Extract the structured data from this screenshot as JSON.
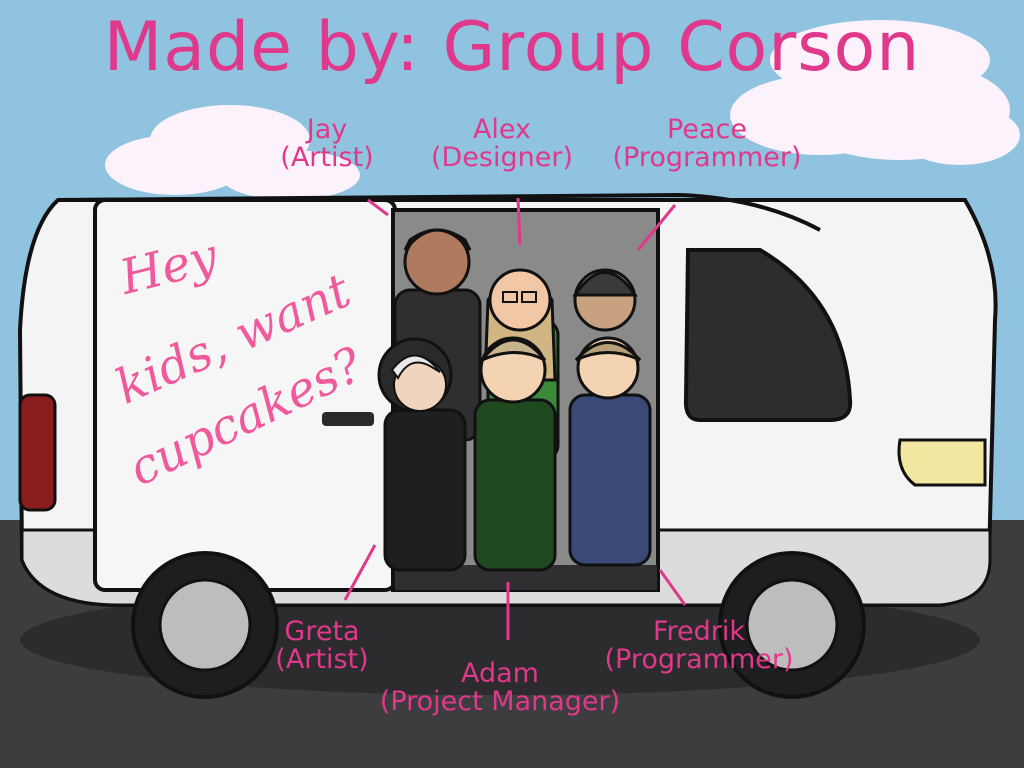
{
  "title": "Made by: Group Corson",
  "van_slogan": {
    "line1": "Hey",
    "line2": "kids, want",
    "line3": "cupcakes?"
  },
  "credits": [
    {
      "name": "Jay",
      "role": "(Artist)"
    },
    {
      "name": "Alex",
      "role": "(Designer)"
    },
    {
      "name": "Peace",
      "role": "(Programmer)"
    },
    {
      "name": "Greta",
      "role": "(Artist)"
    },
    {
      "name": "Adam",
      "role": "(Project Manager)"
    },
    {
      "name": "Fredrik",
      "role": "(Programmer)"
    }
  ],
  "colors": {
    "sky": "#8fc3e0",
    "road": "#3d3d40",
    "text": "#e0388a",
    "van_body": "#f4f4f4"
  }
}
